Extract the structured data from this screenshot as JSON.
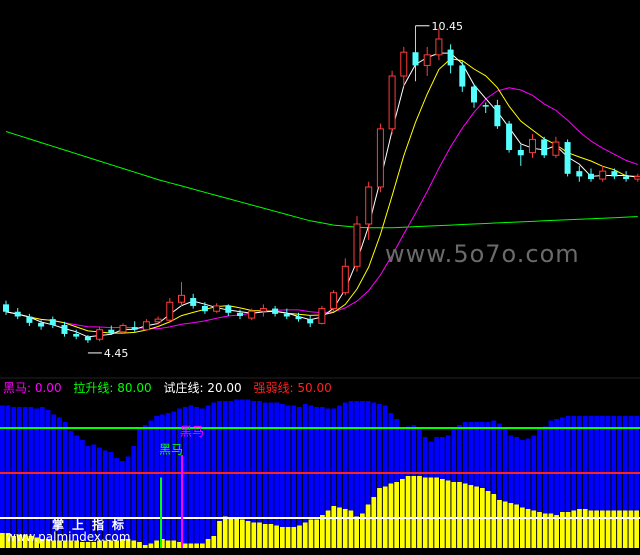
{
  "chart_data": [
    {
      "type": "candlestick",
      "title": "",
      "price_markers": {
        "high": "10.45",
        "low": "4.45"
      },
      "ylim": [
        3.9,
        10.9
      ],
      "candles": [
        {
          "o": 5.18,
          "h": 5.25,
          "c": 5.04,
          "l": 4.98,
          "up": false
        },
        {
          "o": 5.04,
          "h": 5.11,
          "c": 4.95,
          "l": 4.9,
          "up": false
        },
        {
          "o": 4.95,
          "h": 5.0,
          "c": 4.83,
          "l": 4.77,
          "up": false
        },
        {
          "o": 4.83,
          "h": 4.88,
          "c": 4.76,
          "l": 4.7,
          "up": false
        },
        {
          "o": 4.9,
          "h": 4.95,
          "c": 4.79,
          "l": 4.73,
          "up": false
        },
        {
          "o": 4.79,
          "h": 4.85,
          "c": 4.62,
          "l": 4.57,
          "up": false
        },
        {
          "o": 4.62,
          "h": 4.7,
          "c": 4.57,
          "l": 4.52,
          "up": false
        },
        {
          "o": 4.57,
          "h": 4.6,
          "c": 4.5,
          "l": 4.45,
          "up": false
        },
        {
          "o": 4.52,
          "h": 4.75,
          "c": 4.7,
          "l": 4.48,
          "up": true
        },
        {
          "o": 4.7,
          "h": 4.78,
          "c": 4.64,
          "l": 4.6,
          "up": false
        },
        {
          "o": 4.66,
          "h": 4.82,
          "c": 4.78,
          "l": 4.62,
          "up": true
        },
        {
          "o": 4.75,
          "h": 4.86,
          "c": 4.7,
          "l": 4.66,
          "up": false
        },
        {
          "o": 4.7,
          "h": 4.9,
          "c": 4.85,
          "l": 4.68,
          "up": true
        },
        {
          "o": 4.85,
          "h": 4.95,
          "c": 4.9,
          "l": 4.8,
          "up": true
        },
        {
          "o": 4.88,
          "h": 5.3,
          "c": 5.22,
          "l": 4.85,
          "up": true
        },
        {
          "o": 5.22,
          "h": 5.6,
          "c": 5.35,
          "l": 5.15,
          "up": true
        },
        {
          "o": 5.3,
          "h": 5.38,
          "c": 5.15,
          "l": 5.1,
          "up": false
        },
        {
          "o": 5.15,
          "h": 5.22,
          "c": 5.05,
          "l": 5.0,
          "up": false
        },
        {
          "o": 5.05,
          "h": 5.2,
          "c": 5.15,
          "l": 5.02,
          "up": true
        },
        {
          "o": 5.15,
          "h": 5.18,
          "c": 5.02,
          "l": 4.96,
          "up": false
        },
        {
          "o": 5.02,
          "h": 5.08,
          "c": 4.96,
          "l": 4.9,
          "up": false
        },
        {
          "o": 4.92,
          "h": 5.1,
          "c": 5.05,
          "l": 4.88,
          "up": true
        },
        {
          "o": 5.05,
          "h": 5.18,
          "c": 5.1,
          "l": 4.95,
          "up": true
        },
        {
          "o": 5.1,
          "h": 5.15,
          "c": 5.0,
          "l": 4.95,
          "up": false
        },
        {
          "o": 5.0,
          "h": 5.1,
          "c": 4.95,
          "l": 4.9,
          "up": false
        },
        {
          "o": 4.95,
          "h": 5.02,
          "c": 4.9,
          "l": 4.85,
          "up": false
        },
        {
          "o": 4.9,
          "h": 4.96,
          "c": 4.82,
          "l": 4.75,
          "up": false
        },
        {
          "o": 4.82,
          "h": 5.15,
          "c": 5.1,
          "l": 4.8,
          "up": true
        },
        {
          "o": 5.1,
          "h": 5.45,
          "c": 5.4,
          "l": 5.05,
          "up": true
        },
        {
          "o": 5.4,
          "h": 6.05,
          "c": 5.9,
          "l": 5.35,
          "up": true
        },
        {
          "o": 5.9,
          "h": 6.85,
          "c": 6.7,
          "l": 5.8,
          "up": true
        },
        {
          "o": 6.7,
          "h": 7.5,
          "c": 7.4,
          "l": 6.4,
          "up": true
        },
        {
          "o": 7.4,
          "h": 8.6,
          "c": 8.5,
          "l": 7.3,
          "up": true
        },
        {
          "o": 8.5,
          "h": 9.6,
          "c": 9.5,
          "l": 8.4,
          "up": true
        },
        {
          "o": 9.5,
          "h": 10.05,
          "c": 9.95,
          "l": 9.3,
          "up": true
        },
        {
          "o": 9.95,
          "h": 10.45,
          "c": 9.7,
          "l": 9.4,
          "up": false
        },
        {
          "o": 9.7,
          "h": 10.05,
          "c": 9.9,
          "l": 9.5,
          "up": true
        },
        {
          "o": 9.9,
          "h": 10.4,
          "c": 10.2,
          "l": 9.8,
          "up": true
        },
        {
          "o": 10.0,
          "h": 10.1,
          "c": 9.7,
          "l": 9.55,
          "up": false
        },
        {
          "o": 9.7,
          "h": 9.78,
          "c": 9.3,
          "l": 9.2,
          "up": false
        },
        {
          "o": 9.3,
          "h": 9.35,
          "c": 9.0,
          "l": 8.9,
          "up": false
        },
        {
          "o": 8.95,
          "h": 9.0,
          "c": 8.92,
          "l": 8.8,
          "up": false
        },
        {
          "o": 8.95,
          "h": 9.05,
          "c": 8.55,
          "l": 8.5,
          "up": false
        },
        {
          "o": 8.6,
          "h": 8.65,
          "c": 8.1,
          "l": 8.05,
          "up": false
        },
        {
          "o": 8.1,
          "h": 8.2,
          "c": 8.0,
          "l": 7.8,
          "up": false
        },
        {
          "o": 8.05,
          "h": 8.4,
          "c": 8.3,
          "l": 7.95,
          "up": true
        },
        {
          "o": 8.3,
          "h": 8.35,
          "c": 8.0,
          "l": 7.95,
          "up": false
        },
        {
          "o": 8.0,
          "h": 8.35,
          "c": 8.25,
          "l": 7.95,
          "up": true
        },
        {
          "o": 8.25,
          "h": 8.3,
          "c": 7.65,
          "l": 7.6,
          "up": false
        },
        {
          "o": 7.7,
          "h": 7.8,
          "c": 7.6,
          "l": 7.5,
          "up": false
        },
        {
          "o": 7.65,
          "h": 7.75,
          "c": 7.55,
          "l": 7.5,
          "up": false
        },
        {
          "o": 7.55,
          "h": 7.8,
          "c": 7.7,
          "l": 7.5,
          "up": true
        },
        {
          "o": 7.7,
          "h": 7.75,
          "c": 7.6,
          "l": 7.55,
          "up": false
        },
        {
          "o": 7.6,
          "h": 7.7,
          "c": 7.55,
          "l": 7.5,
          "up": false
        },
        {
          "o": 7.55,
          "h": 7.65,
          "c": 7.6,
          "l": 7.5,
          "up": true
        }
      ],
      "moving_averages": [
        {
          "color": "#ffffff"
        },
        {
          "color": "#ffff00"
        },
        {
          "color": "#ff00ff"
        },
        {
          "color": "#00ff00",
          "values": [
            8.45,
            8.38,
            8.31,
            8.24,
            8.17,
            8.1,
            8.03,
            7.96,
            7.89,
            7.82,
            7.75,
            7.68,
            7.61,
            7.54,
            7.48,
            7.42,
            7.36,
            7.3,
            7.24,
            7.18,
            7.12,
            7.06,
            7.0,
            6.94,
            6.88,
            6.82,
            6.76,
            6.72,
            6.68,
            6.66,
            6.64,
            6.63,
            6.63,
            6.63,
            6.64,
            6.65,
            6.66,
            6.67,
            6.68,
            6.69,
            6.7,
            6.71,
            6.72,
            6.73,
            6.74,
            6.75,
            6.76,
            6.77,
            6.78,
            6.79,
            6.8,
            6.81,
            6.82,
            6.83,
            6.84
          ]
        }
      ]
    },
    {
      "type": "bar",
      "title": "黑马",
      "legend": [
        {
          "label": "黑马: 0.00",
          "color": "#ff00ff"
        },
        {
          "label": "拉升线: 80.00",
          "color": "#00ff00"
        },
        {
          "label": "试庄线: 20.00",
          "color": "#ffffff"
        },
        {
          "label": "强弱线: 50.00",
          "color": "#ff2020"
        }
      ],
      "ylim": [
        0,
        100
      ],
      "reference_lines": [
        {
          "name": "拉升线",
          "value": 80,
          "color": "#00ff00"
        },
        {
          "name": "强弱线",
          "value": 50,
          "color": "#ff2020"
        },
        {
          "name": "试庄线",
          "value": 20,
          "color": "#ffffff"
        }
      ],
      "series": [
        {
          "color": "#0000ff",
          "values": [
            95,
            95,
            94,
            94,
            94,
            94,
            93,
            94,
            92,
            89,
            87,
            84,
            78,
            75,
            72,
            68,
            69,
            67,
            65,
            64,
            60,
            58,
            61,
            68,
            80,
            82,
            85,
            88,
            89,
            90,
            91,
            93,
            94,
            95,
            94,
            93,
            95,
            97,
            98,
            98,
            98,
            99,
            99,
            99,
            98,
            98,
            97,
            97,
            97,
            96,
            95,
            95,
            94,
            96,
            95,
            94,
            94,
            93,
            93,
            95,
            97,
            98,
            98,
            98,
            98,
            97,
            96,
            95,
            90,
            86,
            80,
            81,
            82,
            80,
            74,
            71,
            74,
            74,
            75,
            80,
            82,
            84,
            84,
            84,
            84,
            84,
            85,
            83,
            80,
            75,
            74,
            72,
            73,
            75,
            80,
            81,
            85,
            86,
            87,
            88,
            88,
            88,
            88,
            88,
            88,
            88,
            88,
            88,
            88,
            88,
            88,
            88
          ]
        },
        {
          "color": "#ffff00",
          "values": [
            10,
            10,
            8,
            9,
            9,
            8,
            7,
            6,
            6,
            5,
            5,
            5,
            5,
            5,
            4,
            4,
            4,
            5,
            5,
            5,
            5,
            6,
            6,
            5,
            4,
            2,
            3,
            5,
            6,
            5,
            5,
            4,
            3,
            3,
            3,
            3,
            6,
            8,
            18,
            21,
            20,
            20,
            19,
            18,
            17,
            17,
            16,
            16,
            15,
            14,
            14,
            14,
            15,
            17,
            19,
            19,
            22,
            25,
            28,
            27,
            26,
            25,
            21,
            23,
            29,
            34,
            40,
            41,
            43,
            44,
            46,
            48,
            48,
            48,
            47,
            47,
            47,
            46,
            45,
            44,
            44,
            43,
            42,
            41,
            40,
            38,
            36,
            32,
            31,
            30,
            29,
            27,
            26,
            25,
            24,
            23,
            23,
            22,
            24,
            24,
            25,
            26,
            26,
            25,
            25,
            25,
            25,
            25,
            25,
            25,
            25,
            25
          ]
        }
      ],
      "signal_labels": [
        "黑马",
        "黑马"
      ]
    }
  ],
  "watermark": "www.5o7o.com",
  "bottom_labels": {
    "title": "掌上指标",
    "url": "www.palmindex.com"
  }
}
